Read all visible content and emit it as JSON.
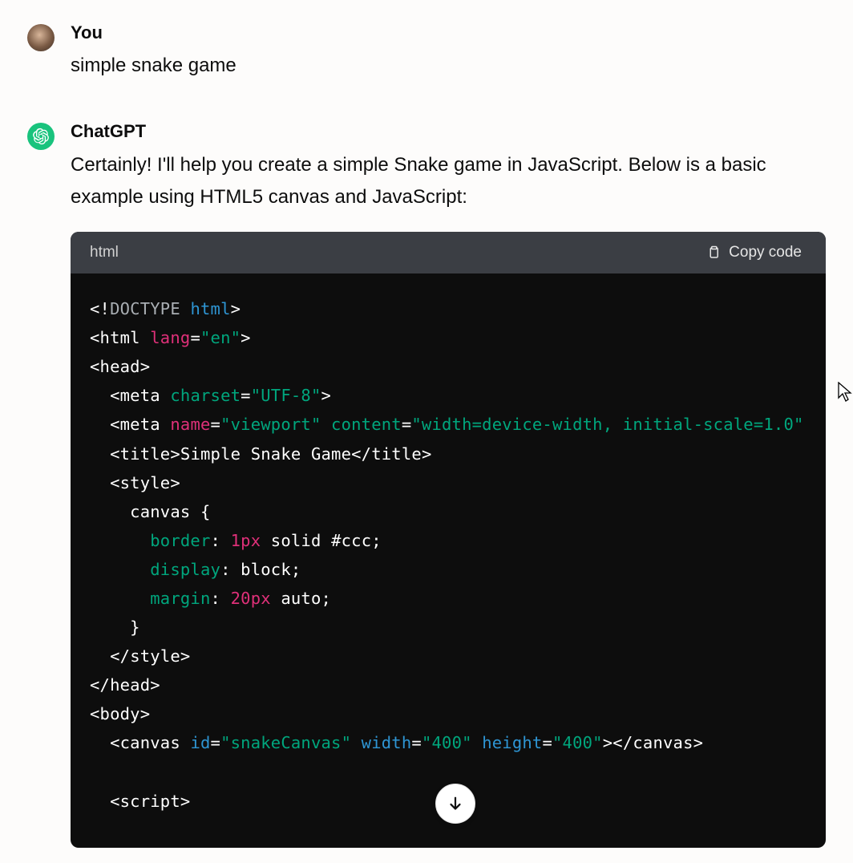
{
  "user": {
    "author": "You",
    "message": "simple snake game"
  },
  "assistant": {
    "author": "ChatGPT",
    "message": "Certainly! I'll help you create a simple Snake game in JavaScript. Below is a basic example using HTML5 canvas and JavaScript:"
  },
  "code_block": {
    "language": "html",
    "copy_label": "Copy code",
    "lines": [
      [
        {
          "t": "t-punc",
          "v": "<!"
        },
        {
          "t": "t-doct",
          "v": "DOCTYPE "
        },
        {
          "t": "t-attr2",
          "v": "html"
        },
        {
          "t": "t-punc",
          "v": ">"
        }
      ],
      [
        {
          "t": "t-punc",
          "v": "<"
        },
        {
          "t": "t-tag",
          "v": "html "
        },
        {
          "t": "t-kw",
          "v": "lang"
        },
        {
          "t": "t-punc",
          "v": "="
        },
        {
          "t": "t-str",
          "v": "\"en\""
        },
        {
          "t": "t-punc",
          "v": ">"
        }
      ],
      [
        {
          "t": "t-punc",
          "v": "<"
        },
        {
          "t": "t-tag",
          "v": "head"
        },
        {
          "t": "t-punc",
          "v": ">"
        }
      ],
      [
        {
          "t": "",
          "v": "  "
        },
        {
          "t": "t-punc",
          "v": "<"
        },
        {
          "t": "t-tag",
          "v": "meta "
        },
        {
          "t": "t-attr",
          "v": "charset"
        },
        {
          "t": "t-punc",
          "v": "="
        },
        {
          "t": "t-str",
          "v": "\"UTF-8\""
        },
        {
          "t": "t-punc",
          "v": ">"
        }
      ],
      [
        {
          "t": "",
          "v": "  "
        },
        {
          "t": "t-punc",
          "v": "<"
        },
        {
          "t": "t-tag",
          "v": "meta "
        },
        {
          "t": "t-kw",
          "v": "name"
        },
        {
          "t": "t-punc",
          "v": "="
        },
        {
          "t": "t-str",
          "v": "\"viewport\" "
        },
        {
          "t": "t-attr",
          "v": "content"
        },
        {
          "t": "t-punc",
          "v": "="
        },
        {
          "t": "t-str",
          "v": "\"width=device-width, initial-scale=1.0\""
        }
      ],
      [
        {
          "t": "",
          "v": "  "
        },
        {
          "t": "t-punc",
          "v": "<"
        },
        {
          "t": "t-tag",
          "v": "title"
        },
        {
          "t": "t-punc",
          "v": ">"
        },
        {
          "t": "t-val",
          "v": "Simple Snake Game"
        },
        {
          "t": "t-punc",
          "v": "</"
        },
        {
          "t": "t-tag",
          "v": "title"
        },
        {
          "t": "t-punc",
          "v": ">"
        }
      ],
      [
        {
          "t": "",
          "v": "  "
        },
        {
          "t": "t-punc",
          "v": "<"
        },
        {
          "t": "t-tag",
          "v": "style"
        },
        {
          "t": "t-punc",
          "v": ">"
        }
      ],
      [
        {
          "t": "",
          "v": "    "
        },
        {
          "t": "t-val",
          "v": "canvas {"
        }
      ],
      [
        {
          "t": "",
          "v": "      "
        },
        {
          "t": "t-attr",
          "v": "border"
        },
        {
          "t": "t-punc",
          "v": ": "
        },
        {
          "t": "t-num",
          "v": "1px"
        },
        {
          "t": "t-val",
          "v": " solid "
        },
        {
          "t": "t-val",
          "v": "#ccc"
        },
        {
          "t": "t-punc",
          "v": ";"
        }
      ],
      [
        {
          "t": "",
          "v": "      "
        },
        {
          "t": "t-attr",
          "v": "display"
        },
        {
          "t": "t-punc",
          "v": ": "
        },
        {
          "t": "t-val",
          "v": "block"
        },
        {
          "t": "t-punc",
          "v": ";"
        }
      ],
      [
        {
          "t": "",
          "v": "      "
        },
        {
          "t": "t-attr",
          "v": "margin"
        },
        {
          "t": "t-punc",
          "v": ": "
        },
        {
          "t": "t-num",
          "v": "20px"
        },
        {
          "t": "t-val",
          "v": " auto"
        },
        {
          "t": "t-punc",
          "v": ";"
        }
      ],
      [
        {
          "t": "",
          "v": "    "
        },
        {
          "t": "t-val",
          "v": "}"
        }
      ],
      [
        {
          "t": "",
          "v": "  "
        },
        {
          "t": "t-punc",
          "v": "</"
        },
        {
          "t": "t-tag",
          "v": "style"
        },
        {
          "t": "t-punc",
          "v": ">"
        }
      ],
      [
        {
          "t": "t-punc",
          "v": "</"
        },
        {
          "t": "t-tag",
          "v": "head"
        },
        {
          "t": "t-punc",
          "v": ">"
        }
      ],
      [
        {
          "t": "t-punc",
          "v": "<"
        },
        {
          "t": "t-tag",
          "v": "body"
        },
        {
          "t": "t-punc",
          "v": ">"
        }
      ],
      [
        {
          "t": "",
          "v": "  "
        },
        {
          "t": "t-punc",
          "v": "<"
        },
        {
          "t": "t-tag",
          "v": "canvas "
        },
        {
          "t": "t-attr2",
          "v": "id"
        },
        {
          "t": "t-punc",
          "v": "="
        },
        {
          "t": "t-str",
          "v": "\"snakeCanvas\" "
        },
        {
          "t": "t-attr2",
          "v": "width"
        },
        {
          "t": "t-punc",
          "v": "="
        },
        {
          "t": "t-str",
          "v": "\"400\" "
        },
        {
          "t": "t-attr2",
          "v": "height"
        },
        {
          "t": "t-punc",
          "v": "="
        },
        {
          "t": "t-str",
          "v": "\"400\""
        },
        {
          "t": "t-punc",
          "v": "></"
        },
        {
          "t": "t-tag",
          "v": "canvas"
        },
        {
          "t": "t-punc",
          "v": ">"
        }
      ],
      [
        {
          "t": "",
          "v": ""
        }
      ],
      [
        {
          "t": "",
          "v": "  "
        },
        {
          "t": "t-punc",
          "v": "<"
        },
        {
          "t": "t-tag",
          "v": "script"
        },
        {
          "t": "t-punc",
          "v": ">"
        }
      ]
    ]
  }
}
